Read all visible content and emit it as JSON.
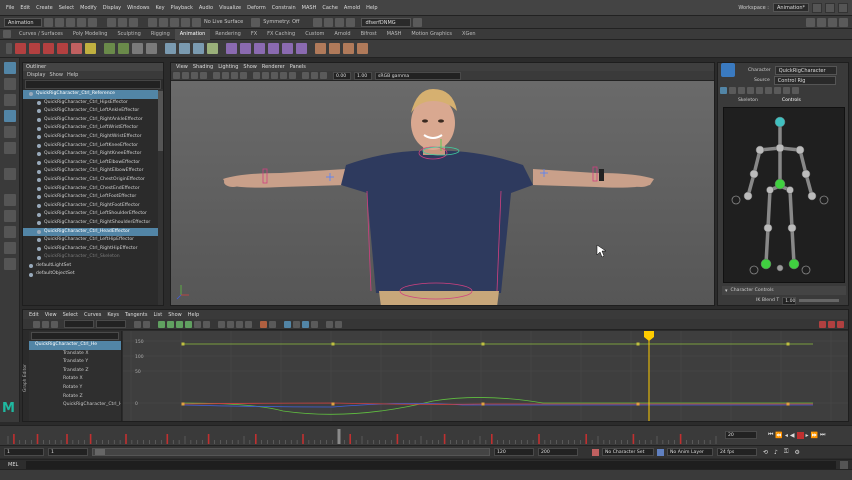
{
  "menubar": {
    "items": [
      "File",
      "Edit",
      "Create",
      "Select",
      "Modify",
      "Display",
      "Windows",
      "Key",
      "Playback",
      "Audio",
      "Visualize",
      "Deform",
      "Constrain",
      "MASH",
      "Cache",
      "Arnold",
      "Help"
    ],
    "workspace_label": "Workspace :",
    "workspace_value": "Animation*"
  },
  "statusline": {
    "mode": "Animation",
    "live_surface": "No Live Surface",
    "symmetry": "Symmetry: Off",
    "object": "dfserfDNMG"
  },
  "shelf": {
    "tabs": [
      "Curves / Surfaces",
      "Poly Modeling",
      "Sculpting",
      "Rigging",
      "Animation",
      "Rendering",
      "FX",
      "FX Caching",
      "Custom",
      "Arnold",
      "Bifrost",
      "MASH",
      "Motion Graphics",
      "XGen"
    ],
    "active_tab": "Animation"
  },
  "outliner": {
    "title": "Outliner",
    "menus": [
      "Display",
      "Show",
      "Help"
    ],
    "items": [
      {
        "label": "QuickRigCharacter_Ctrl_Reference",
        "level": 0,
        "state": "sel"
      },
      {
        "label": "QuickRigCharacter_Ctrl_HipsEffector",
        "level": 1,
        "state": ""
      },
      {
        "label": "QuickRigCharacter_Ctrl_LeftAnkleEffector",
        "level": 1,
        "state": ""
      },
      {
        "label": "QuickRigCharacter_Ctrl_RightAnkleEffector",
        "level": 1,
        "state": ""
      },
      {
        "label": "QuickRigCharacter_Ctrl_LeftWristEffector",
        "level": 1,
        "state": ""
      },
      {
        "label": "QuickRigCharacter_Ctrl_RightWristEffector",
        "level": 1,
        "state": ""
      },
      {
        "label": "QuickRigCharacter_Ctrl_LeftKneeEffector",
        "level": 1,
        "state": ""
      },
      {
        "label": "QuickRigCharacter_Ctrl_RightKneeEffector",
        "level": 1,
        "state": ""
      },
      {
        "label": "QuickRigCharacter_Ctrl_LeftElbowEffector",
        "level": 1,
        "state": ""
      },
      {
        "label": "QuickRigCharacter_Ctrl_RightElbowEffector",
        "level": 1,
        "state": ""
      },
      {
        "label": "QuickRigCharacter_Ctrl_ChestOriginEffector",
        "level": 1,
        "state": ""
      },
      {
        "label": "QuickRigCharacter_Ctrl_ChestEndEffector",
        "level": 1,
        "state": ""
      },
      {
        "label": "QuickRigCharacter_Ctrl_LeftFootEffector",
        "level": 1,
        "state": ""
      },
      {
        "label": "QuickRigCharacter_Ctrl_RightFootEffector",
        "level": 1,
        "state": ""
      },
      {
        "label": "QuickRigCharacter_Ctrl_LeftShoulderEffector",
        "level": 1,
        "state": ""
      },
      {
        "label": "QuickRigCharacter_Ctrl_RightShoulderEffector",
        "level": 1,
        "state": ""
      },
      {
        "label": "QuickRigCharacter_Ctrl_HeadEffector",
        "level": 1,
        "state": "sel"
      },
      {
        "label": "QuickRigCharacter_Ctrl_LeftHipEffector",
        "level": 1,
        "state": ""
      },
      {
        "label": "QuickRigCharacter_Ctrl_RightHipEffector",
        "level": 1,
        "state": ""
      },
      {
        "label": "QuickRigCharacter_Ctrl_Skeleton",
        "level": 1,
        "state": "dim"
      },
      {
        "label": "defaultLightSet",
        "level": 0,
        "state": ""
      },
      {
        "label": "defaultObjectSet",
        "level": 0,
        "state": ""
      }
    ]
  },
  "viewport": {
    "menus": [
      "View",
      "Shading",
      "Lighting",
      "Show",
      "Renderer",
      "Panels"
    ],
    "near_clip": "0.00",
    "far_clip": "1.00",
    "color_space": "sRGB gamma"
  },
  "hik": {
    "character_label": "Character",
    "character_value": "QuickRigCharacter",
    "source_label": "Source",
    "source_value": "Control Rig",
    "tabs": [
      "Skeleton",
      "Controls"
    ],
    "footer": "Character Controls",
    "blend_label": "IK Blend T",
    "blend_value": "1.00"
  },
  "graph": {
    "menus": [
      "Edit",
      "View",
      "Select",
      "Curves",
      "Keys",
      "Tangents",
      "List",
      "Show",
      "Help"
    ],
    "side_label": "Graph Editor",
    "curves": [
      {
        "label": "QuickRigCharacter_Ctrl_He",
        "selected": true
      },
      {
        "label": "Translate X",
        "selected": false
      },
      {
        "label": "Translate Y",
        "selected": false
      },
      {
        "label": "Translate Z",
        "selected": false
      },
      {
        "label": "Rotate X",
        "selected": false
      },
      {
        "label": "Rotate Y",
        "selected": false
      },
      {
        "label": "Rotate Z",
        "selected": false
      },
      {
        "label": "QuickRigCharacter_Ctrl_HeadEffe",
        "selected": false
      }
    ],
    "y_ticks": [
      "150",
      "100",
      "50",
      "0"
    ],
    "playhead_frame": 20
  },
  "timeline": {
    "start_frame": "1",
    "end_frame": "120",
    "range_start": "1",
    "range_end": "120",
    "range_max": "200",
    "current_frame": "20",
    "character_set": "No Character Set",
    "anim_layer": "No Anim Layer",
    "fps": "24 fps"
  },
  "cmd": {
    "lang": "MEL"
  },
  "colors": {
    "selection": "#5285a6",
    "playhead": "#ffcc00",
    "curve_x": "#d04040",
    "curve_y": "#60c040",
    "curve_z": "#4060e0"
  }
}
